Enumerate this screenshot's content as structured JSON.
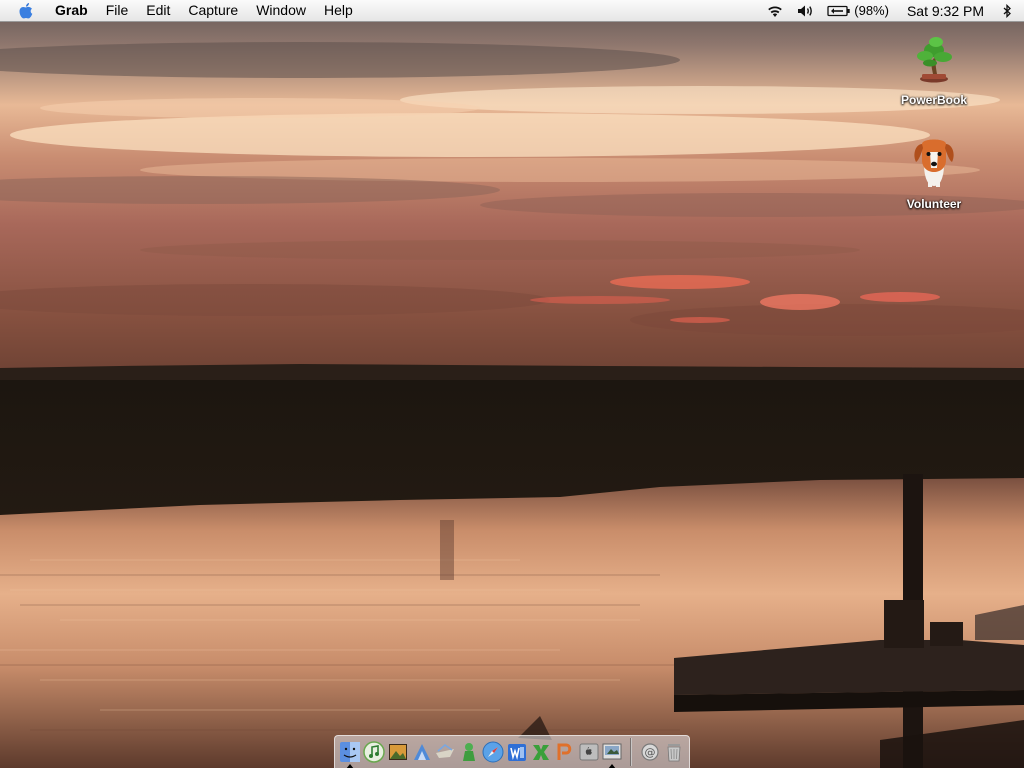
{
  "menubar": {
    "app_name": "Grab",
    "menus": [
      "File",
      "Edit",
      "Capture",
      "Window",
      "Help"
    ],
    "battery_percent": "(98%)",
    "clock": "Sat 9:32 PM",
    "status_icons": [
      "wifi-icon",
      "volume-icon",
      "battery-icon",
      "bluetooth-icon"
    ]
  },
  "desktop": {
    "icons": [
      {
        "label": "PowerBook",
        "icon": "bonsai-tree-icon"
      },
      {
        "label": "Volunteer",
        "icon": "dog-icon"
      }
    ]
  },
  "dock": {
    "items": [
      {
        "icon": "finder-icon",
        "running": true
      },
      {
        "icon": "itunes-icon",
        "running": false
      },
      {
        "icon": "preview-icon",
        "running": false
      },
      {
        "icon": "xcode-icon",
        "running": false
      },
      {
        "icon": "mail-icon",
        "running": false
      },
      {
        "icon": "ichat-icon",
        "running": false
      },
      {
        "icon": "safari-icon",
        "running": false
      },
      {
        "icon": "word-icon",
        "running": false
      },
      {
        "icon": "excel-icon",
        "running": false
      },
      {
        "icon": "powerpoint-icon",
        "running": false
      },
      {
        "icon": "system-preferences-icon",
        "running": false
      },
      {
        "icon": "grab-icon",
        "running": true
      }
    ],
    "trailing": [
      {
        "icon": "documents-stack-icon"
      },
      {
        "icon": "trash-icon"
      }
    ]
  },
  "colors": {
    "sky_top": "#6b5a57",
    "sky_glow": "#f3c39b",
    "sky_low": "#b07058",
    "cloud_pink": "#f06a55",
    "marsh": "#1f1810",
    "water_light": "#d6a07a",
    "water_dark": "#4a2d24"
  }
}
